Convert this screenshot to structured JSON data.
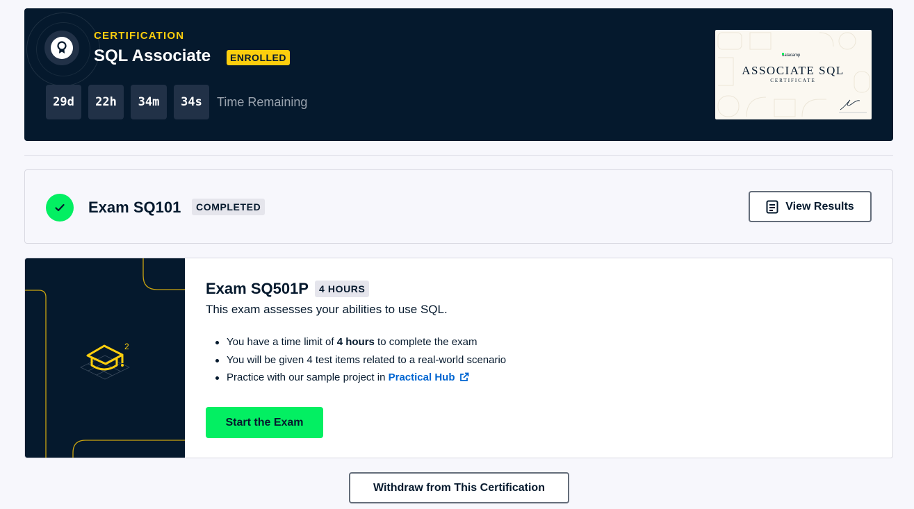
{
  "header": {
    "kicker": "CERTIFICATION",
    "title": "SQL Associate",
    "status_badge": "ENROLLED",
    "timer": {
      "days": "29d",
      "hours": "22h",
      "minutes": "34m",
      "seconds": "34s",
      "label": "Time Remaining"
    },
    "certificate_preview": {
      "brand": "datacamp",
      "title": "ASSOCIATE SQL",
      "subtitle": "CERTIFICATE"
    }
  },
  "exam_completed": {
    "title": "Exam SQ101",
    "status": "COMPLETED",
    "action_label": "View Results"
  },
  "exam_next": {
    "title": "Exam SQ501P",
    "duration_badge": "4 HOURS",
    "description": "This exam assesses your abilities to use SQL.",
    "bullets": {
      "b1_pre": "You have a time limit of ",
      "b1_bold": "4 hours",
      "b1_post": " to complete the exam",
      "b2": "You will be given 4 test items related to a real-world scenario",
      "b3_pre": "Practice with our sample project in ",
      "b3_link": "Practical Hub"
    },
    "art_superscript": "2",
    "start_label": "Start the Exam"
  },
  "withdraw_label": "Withdraw from This Certification",
  "colors": {
    "navy": "#05192d",
    "yellow": "#fcce0d",
    "green": "#03ef62",
    "link_blue": "#0065d1"
  }
}
